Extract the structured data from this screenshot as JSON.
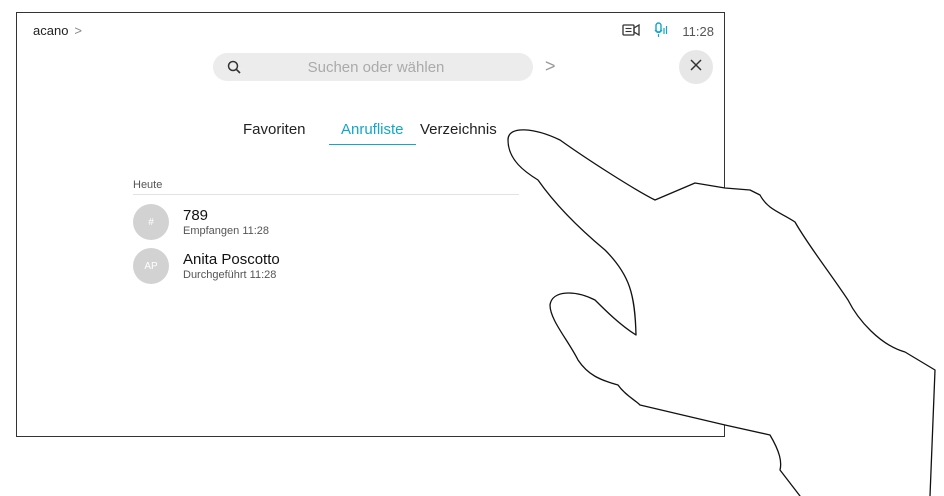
{
  "header": {
    "breadcrumb": "acano",
    "breadcrumb_chevron": ">",
    "time": "11:28",
    "icons": [
      "camera-icon",
      "microphone-icon"
    ]
  },
  "search": {
    "placeholder": "Suchen oder wählen",
    "go_glyph": ">",
    "close_glyph": "×"
  },
  "tabs": [
    {
      "label": "Favoriten",
      "active": false
    },
    {
      "label": "Anrufliste",
      "active": true
    },
    {
      "label": "Verzeichnis",
      "active": false
    }
  ],
  "section": {
    "label": "Heute"
  },
  "calls": [
    {
      "avatar": "#",
      "name": "789",
      "detail": "Empfangen 11:28"
    },
    {
      "avatar": "AP",
      "name": "Anita Poscotto",
      "detail": "Durchgeführt 11:28"
    }
  ],
  "colors": {
    "accent": "#11a7c9",
    "avatar_bg": "#d2d2d2",
    "search_bg": "#ececec"
  }
}
